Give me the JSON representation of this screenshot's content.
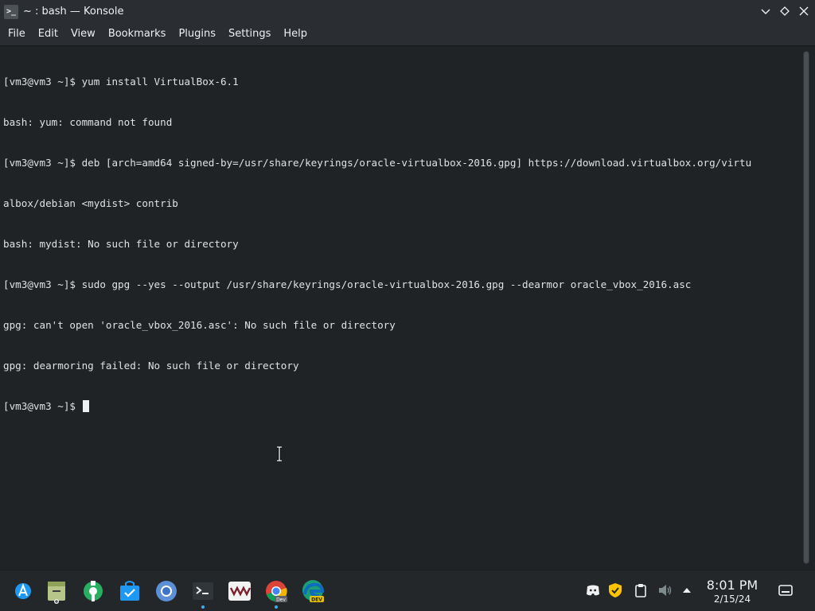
{
  "window": {
    "title": "~ : bash — Konsole",
    "icon": "terminal-icon"
  },
  "menu": {
    "items": [
      "File",
      "Edit",
      "View",
      "Bookmarks",
      "Plugins",
      "Settings",
      "Help"
    ]
  },
  "terminal": {
    "lines": [
      "[vm3@vm3 ~]$ yum install VirtualBox-6.1",
      "bash: yum: command not found",
      "[vm3@vm3 ~]$ deb [arch=amd64 signed-by=/usr/share/keyrings/oracle-virtualbox-2016.gpg] https://download.virtualbox.org/virtu",
      "albox/debian <mydist> contrib",
      "bash: mydist: No such file or directory",
      "[vm3@vm3 ~]$ sudo gpg --yes --output /usr/share/keyrings/oracle-virtualbox-2016.gpg --dearmor oracle_vbox_2016.asc",
      "gpg: can't open 'oracle_vbox_2016.asc': No such file or directory",
      "gpg: dearmoring failed: No such file or directory"
    ],
    "prompt": "[vm3@vm3 ~]$ "
  },
  "taskbar": {
    "apps": [
      {
        "name": "application-launcher-icon"
      },
      {
        "name": "file-manager-icon"
      },
      {
        "name": "system-settings-icon"
      },
      {
        "name": "discover-store-icon"
      },
      {
        "name": "chromium-icon"
      },
      {
        "name": "konsole-icon"
      },
      {
        "name": "vmware-icon",
        "label": "VM"
      },
      {
        "name": "chrome-dev-icon",
        "badge": "Dev"
      },
      {
        "name": "edge-dev-icon",
        "badge": "DEV"
      }
    ],
    "tray": [
      "discord-icon",
      "norton-icon",
      "clipboard-icon",
      "volume-muted-icon",
      "expand-tray-icon"
    ],
    "clock": {
      "time": "8:01 PM",
      "date": "2/15/24"
    },
    "show_desktop": "show-desktop-icon"
  },
  "colors": {
    "terminal_bg": "#202326",
    "terminal_fg": "#dfe1e2",
    "titlebar_bg": "#2a2e32",
    "accent": "#3daee9"
  }
}
